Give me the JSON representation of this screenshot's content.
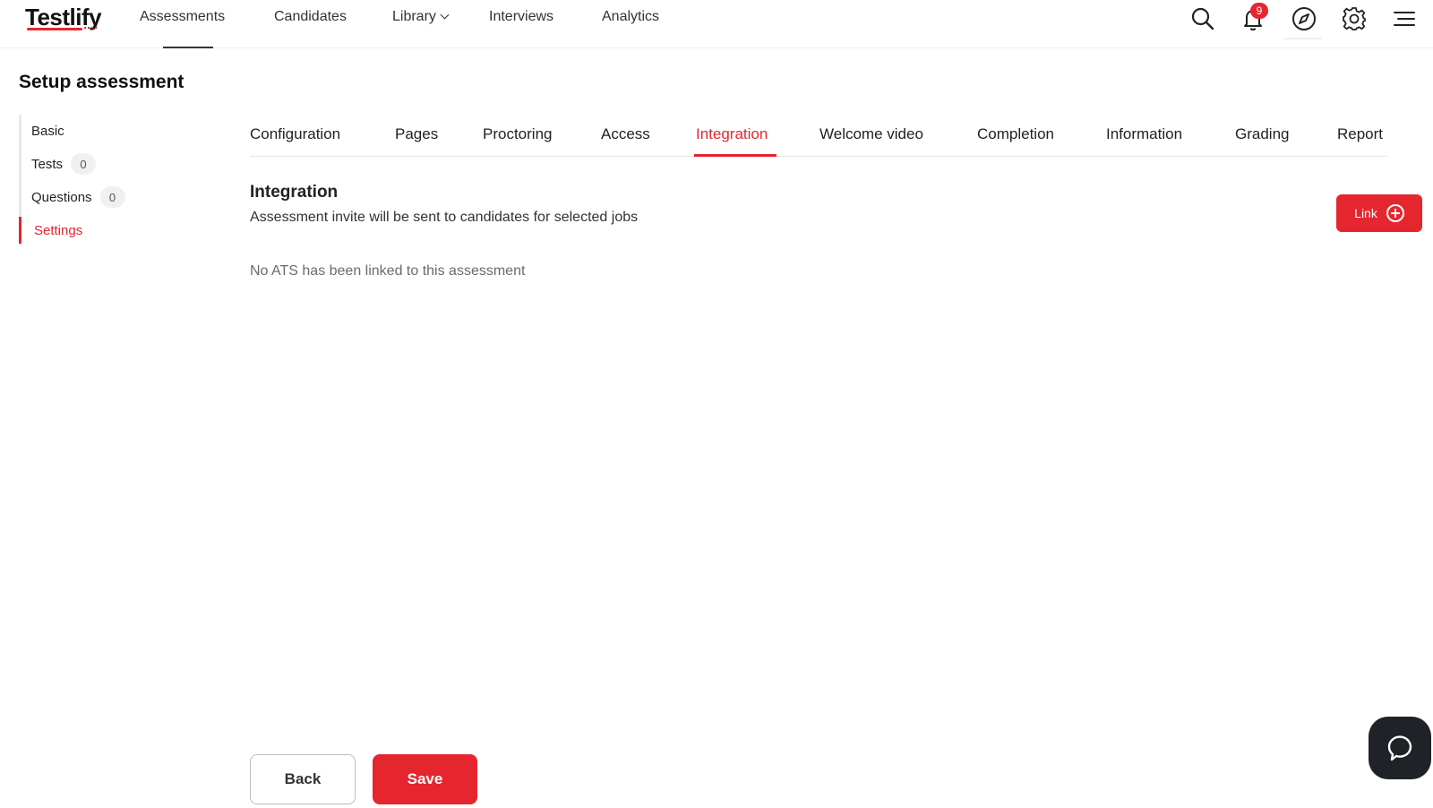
{
  "brand": {
    "logo_text": "Testlify",
    "accent": "#e5262f"
  },
  "topnav": {
    "items": [
      {
        "label": "Assessments"
      },
      {
        "label": "Candidates"
      },
      {
        "label": "Library"
      },
      {
        "label": "Interviews"
      },
      {
        "label": "Analytics"
      }
    ],
    "notification_count": "9",
    "icons": [
      "search-icon",
      "bell-icon",
      "compass-icon",
      "gear-icon",
      "menu-icon"
    ]
  },
  "page": {
    "title": "Setup assessment"
  },
  "sidebar": {
    "items": [
      {
        "label": "Basic"
      },
      {
        "label": "Tests",
        "count": "0"
      },
      {
        "label": "Questions",
        "count": "0"
      },
      {
        "label": "Settings"
      }
    ]
  },
  "tabs": [
    {
      "label": "Configuration"
    },
    {
      "label": "Pages"
    },
    {
      "label": "Proctoring"
    },
    {
      "label": "Access"
    },
    {
      "label": "Integration"
    },
    {
      "label": "Welcome video"
    },
    {
      "label": "Completion"
    },
    {
      "label": "Information"
    },
    {
      "label": "Grading"
    },
    {
      "label": "Report"
    }
  ],
  "integration": {
    "title": "Integration",
    "description": "Assessment invite will be sent to candidates for selected jobs",
    "link_label": "Link",
    "empty_message": "No ATS has been linked to this assessment"
  },
  "footer": {
    "back_label": "Back",
    "save_label": "Save"
  },
  "chat": {
    "icon": "chat-icon"
  }
}
